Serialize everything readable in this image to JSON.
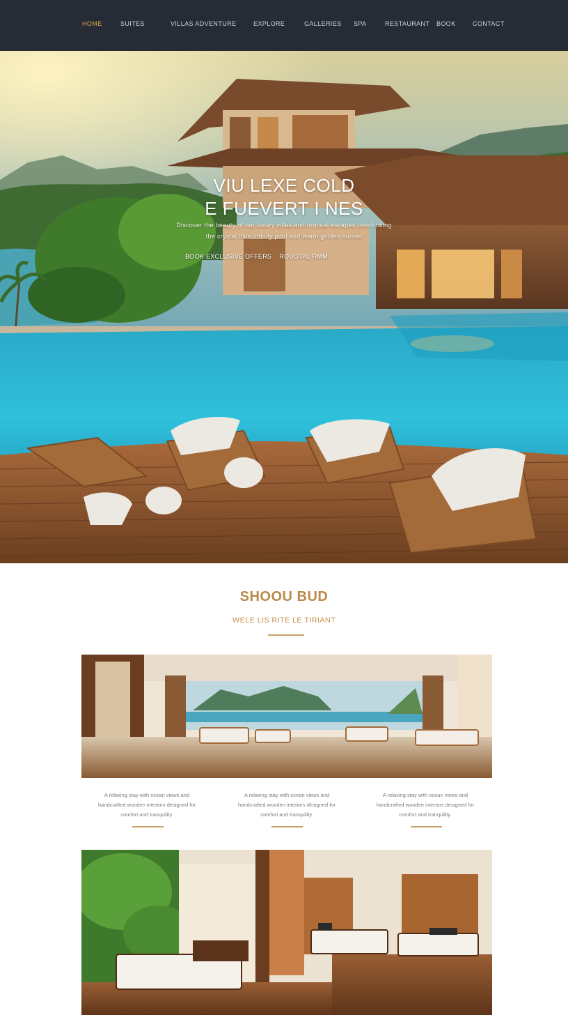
{
  "nav": {
    "items": [
      {
        "label": "HOME",
        "active": true
      },
      {
        "label": "SUITES",
        "active": false
      },
      {
        "label": "VILLAS ADVENTURE",
        "active": false
      },
      {
        "label": "EXPLORE",
        "active": false
      },
      {
        "label": "GALLERIES",
        "active": false
      },
      {
        "label": "SPA",
        "active": false
      },
      {
        "label": "RESTAURANT",
        "active": false
      },
      {
        "label": "BOOK",
        "active": false
      },
      {
        "label": "CONTACT",
        "active": false
      }
    ]
  },
  "hero": {
    "title_line1": "VIU LEXE COLD",
    "title_line2": "E FUEVERT I NES",
    "sub_line1": "Discover the beauty of our luxury villas and tropical escapes overlooking",
    "sub_line2": "the crystal blue infinity pool and warm golden sunset",
    "cta_left": "BOOK EXCLUSIVE OFFERS",
    "cta_right": "ROUOTAL RMM."
  },
  "section": {
    "title": "SHOOU BUD",
    "subtitle": "WELE LIS RITE LE TIRIANT"
  },
  "columns": [
    {
      "line1": "A relaxing stay with ocean views and",
      "line2": "handcrafted wooden interiors designed for",
      "line3": "comfort and tranquility."
    },
    {
      "line1": "A relaxing stay with ocean views and",
      "line2": "handcrafted wooden interiors designed for",
      "line3": "comfort and tranquility."
    },
    {
      "line1": "A relaxing stay with ocean views and",
      "line2": "handcrafted wooden interiors designed for",
      "line3": "comfort and tranquility."
    }
  ],
  "colors": {
    "nav_bg": "#262b35",
    "accent_gold": "#c9a063",
    "nav_active": "#d5a44f"
  }
}
